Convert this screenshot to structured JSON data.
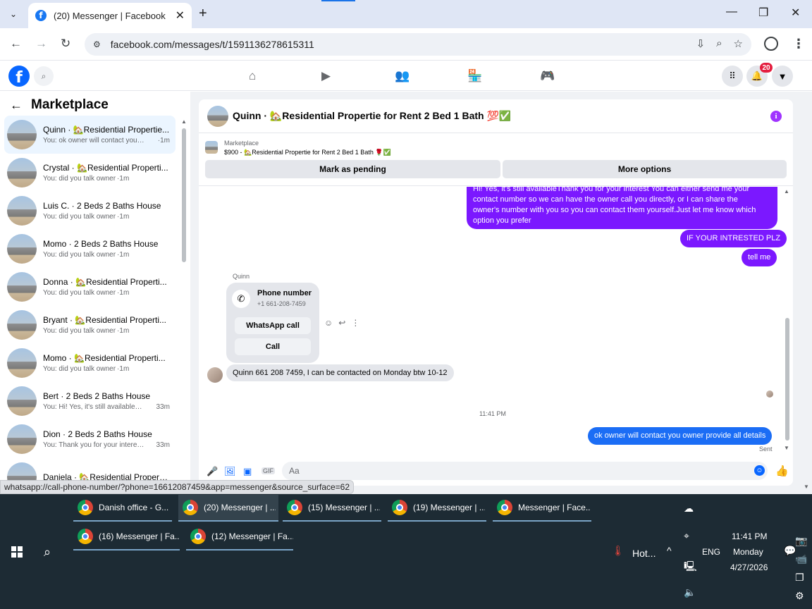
{
  "browser": {
    "active_tab_title": "(20) Messenger | Facebook",
    "url": "facebook.com/messages/t/1591136278615311",
    "status_url": "whatsapp://call-phone-number/?phone=16612087459&app=messenger&source_surface=62"
  },
  "fb_header": {
    "notification_count": "20"
  },
  "sidebar": {
    "title": "Marketplace",
    "conversations": [
      {
        "name": "Quinn · 🏡Residential Propertie...",
        "preview": "You: ok owner will contact you o...",
        "time": "·1m"
      },
      {
        "name": "Crystal · 🏡Residential Properti...",
        "preview": "You: did you talk owner",
        "time": "·1m"
      },
      {
        "name": "Luis C. · 2 Beds 2 Baths House",
        "preview": "You: did you talk owner",
        "time": "·1m"
      },
      {
        "name": "Momo · 2 Beds 2 Baths House",
        "preview": "You: did you talk owner",
        "time": "·1m"
      },
      {
        "name": "Donna · 🏡Residential Properti...",
        "preview": "You: did you talk owner",
        "time": "·1m"
      },
      {
        "name": "Bryant · 🏡Residential Properti...",
        "preview": "You: did you talk owner",
        "time": "·1m"
      },
      {
        "name": "Momo · 🏡Residential Properti...",
        "preview": "You: did you talk owner",
        "time": "·1m"
      },
      {
        "name": "Bert · 2 Beds 2 Baths House",
        "preview": "You: Hi! Yes, it's still availableTha...",
        "time": "33m"
      },
      {
        "name": "Dion · 2 Beds 2 Baths House",
        "preview": "You: Thank you for your interest ...",
        "time": "33m"
      },
      {
        "name": "Daniela · 🏡Residential Properti...",
        "preview": "",
        "time": ""
      }
    ]
  },
  "chat": {
    "title": "Quinn · 🏡Residential Propertie for Rent 2 Bed 1 Bath 💯✅",
    "listing_label": "Marketplace",
    "listing_title": "$900 - 🏡Residential Propertie for Rent 2 Bed 1 Bath 🌹✅",
    "mark_pending_label": "Mark as pending",
    "more_options_label": "More options",
    "msg_long_lines": [
      "Hi! Yes, it's still availableThank you for your interest You can either send me your",
      "contact number so we can have the owner call you directly, or I can share the",
      "owner's number with you so you can contact them yourself.Just let me know which",
      "option you prefer"
    ],
    "msg_interested": "IF YOUR INTRESTED PLZ",
    "msg_tell_me": "tell me",
    "sender_name": "Quinn",
    "contact_label": "Phone number",
    "contact_number": "+1 661-208-7459",
    "whatsapp_call_label": "WhatsApp call",
    "call_label": "Call",
    "msg_incoming": "Quinn 661 208 7459, I can be contacted on Monday btw 10-12",
    "timestamp": "11:41 PM",
    "msg_last": "ok owner will contact you owner provide all details",
    "sent_label": "Sent",
    "composer_placeholder": "Aa"
  },
  "taskbar": {
    "tasks": [
      {
        "label": "Danish office - G..."
      },
      {
        "label": "(20) Messenger | ..."
      },
      {
        "label": "(15) Messenger | ..."
      },
      {
        "label": "(19) Messenger | ..."
      },
      {
        "label": "Messenger | Face..."
      },
      {
        "label": "(16) Messenger | Fa..."
      },
      {
        "label": "(12) Messenger | Fa..."
      }
    ],
    "weather": "Hot...",
    "language": "ENG",
    "time": "11:41 PM",
    "day": "Monday",
    "date": "4/27/2026"
  },
  "colors": {
    "messenger_purple": "#7b18ff",
    "fb_blue": "#0866ff",
    "badge_red": "#e41e3f"
  }
}
